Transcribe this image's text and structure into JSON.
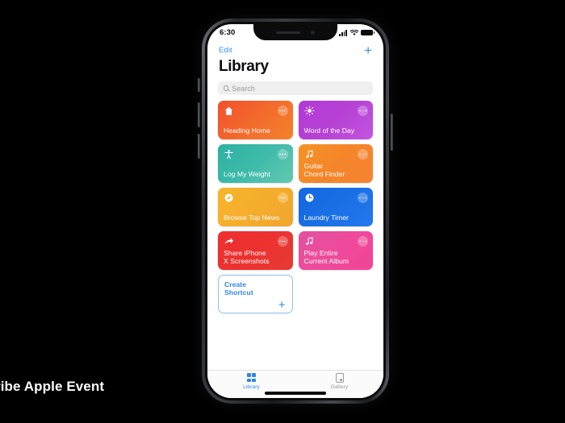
{
  "caption": {
    "text": "ribe Apple Event"
  },
  "device": {
    "buttons": [
      "mute-switch",
      "volume-up",
      "volume-down",
      "power"
    ]
  },
  "status_bar": {
    "time": "6:30",
    "cellular_icon": "signal-bars-icon",
    "wifi_icon": "wifi-icon",
    "battery_icon": "battery-icon"
  },
  "nav": {
    "edit_label": "Edit",
    "add_label": "+",
    "add_icon": "plus-icon"
  },
  "header": {
    "title": "Library"
  },
  "search": {
    "placeholder": "Search",
    "icon": "search-icon"
  },
  "shortcuts": [
    {
      "title": "Heading Home",
      "icon": "house-icon",
      "gradient": "linear-gradient(135deg,#f2502e 0%,#f26a2c 50%,#f5822c 100%)",
      "menu": "more-options-icon"
    },
    {
      "title": "Word of the Day",
      "icon": "brightness-sun-icon",
      "gradient": "linear-gradient(135deg,#b23ad8 0%,#b641d4 50%,#c356e0 100%)",
      "menu": "more-options-icon"
    },
    {
      "title": "Log My Weight",
      "icon": "person-accessibility-icon",
      "gradient": "linear-gradient(135deg,#2cb0a3 0%,#3fbba9 50%,#63c9b2 100%)",
      "menu": "more-options-icon"
    },
    {
      "title": "Guitar\nChord Finder",
      "icon": "music-note-icon",
      "gradient": "linear-gradient(135deg,#f59324 0%,#f5852a 50%,#f58432 100%)",
      "menu": "more-options-icon"
    },
    {
      "title": "Browse Top News",
      "icon": "globe-safari-icon",
      "gradient": "linear-gradient(135deg,#f7b52b 0%,#f5ad2c 50%,#f0a52e 100%)",
      "menu": "more-options-icon"
    },
    {
      "title": "Laundry Timer",
      "icon": "clock-icon",
      "gradient": "linear-gradient(135deg,#1467e0 0%,#1a6fe5 50%,#2478ec 100%)",
      "menu": "more-options-icon"
    },
    {
      "title": "Share iPhone\nX Screenshots",
      "icon": "share-arrow-icon",
      "gradient": "linear-gradient(135deg,#ef2f30 0%,#ec3230 50%,#e63a33 100%)",
      "menu": "more-options-icon"
    },
    {
      "title": "Play Entire\nCurrent Album",
      "icon": "music-note-icon",
      "gradient": "linear-gradient(135deg,#e2529e 0%,#ee4a9c 50%,#f24497 100%)",
      "menu": "more-options-icon"
    }
  ],
  "create_shortcut": {
    "title": "Create\nShortcut",
    "plus": "+",
    "plus_icon": "plus-icon",
    "border_color": "#8fc0f0",
    "text_color": "#2f86e8"
  },
  "tab_bar": {
    "tabs": [
      {
        "label": "Library",
        "icon": "grid-squares-icon",
        "active": true,
        "color": "#2f86e8"
      },
      {
        "label": "Gallery",
        "icon": "gallery-card-icon",
        "active": false,
        "color": "#9a9aa0"
      }
    ]
  },
  "colors": {
    "accent_blue": "#2f86e8",
    "nav_blue": "#3c8ef0",
    "search_field": "#efeff0",
    "tab_bar_bg": "#fbfbfb",
    "background": "#000000"
  }
}
